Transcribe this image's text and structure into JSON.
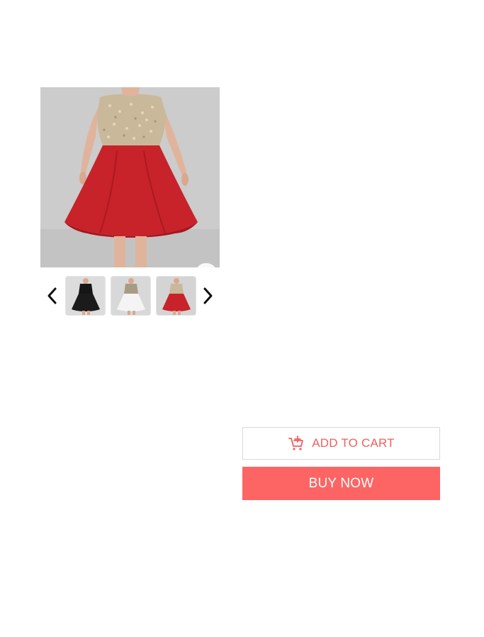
{
  "product": {
    "main_image": {
      "icon": "dress-photo-red-sequin",
      "skirt_color": "#c8222a",
      "top_color": "#c9b99a"
    },
    "zoom_badge_icon": "zoom-icon"
  },
  "gallery": {
    "prev_icon": "chevron-left-icon",
    "next_icon": "chevron-right-icon",
    "thumbnails": [
      {
        "icon": "dress-thumbnail-black",
        "color": "#151515"
      },
      {
        "icon": "dress-thumbnail-white",
        "color": "#f4f4f4"
      },
      {
        "icon": "dress-thumbnail-red",
        "color": "#c8222a"
      }
    ]
  },
  "actions": {
    "add_to_cart_label": "ADD TO CART",
    "add_to_cart_icon": "add-cart-icon",
    "buy_now_label": "BUY NOW",
    "accent_color": "#fd6464"
  }
}
